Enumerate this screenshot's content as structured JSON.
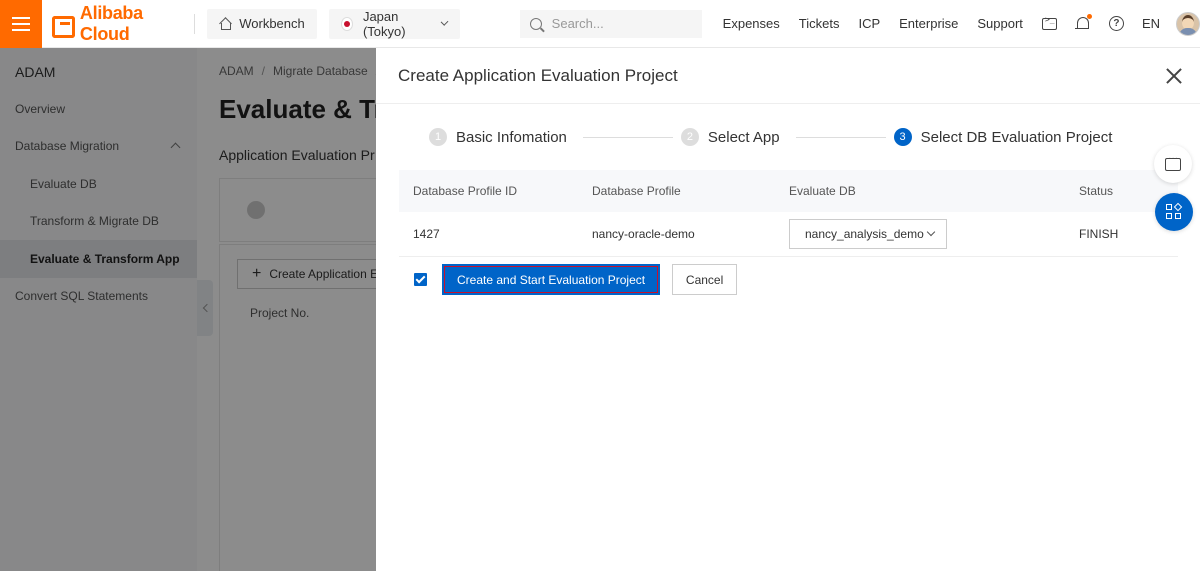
{
  "topbar": {
    "brand": "Alibaba Cloud",
    "workbench": "Workbench",
    "region": "Japan (Tokyo)",
    "search_placeholder": "Search...",
    "links": [
      "Expenses",
      "Tickets",
      "ICP",
      "Enterprise",
      "Support"
    ],
    "language": "EN"
  },
  "sidebar": {
    "title": "ADAM",
    "items": [
      {
        "label": "Overview"
      },
      {
        "label": "Database Migration"
      },
      {
        "label": "Evaluate DB"
      },
      {
        "label": "Transform & Migrate DB"
      },
      {
        "label": "Evaluate & Transform App"
      },
      {
        "label": "Convert SQL Statements"
      }
    ]
  },
  "main": {
    "breadcrumb": [
      "ADAM",
      "Migrate Database",
      "/"
    ],
    "title": "Evaluate & Tr",
    "subtitle": "Application Evaluation Pr",
    "create_button": "Create Application Ev",
    "project_column": "Project No."
  },
  "drawer": {
    "title": "Create Application Evaluation Project",
    "steps": [
      {
        "num": "1",
        "label": "Basic Infomation"
      },
      {
        "num": "2",
        "label": "Select App"
      },
      {
        "num": "3",
        "label": "Select DB Evaluation Project"
      }
    ],
    "table": {
      "headers": [
        "Database Profile ID",
        "Database Profile",
        "Evaluate DB",
        "Status"
      ],
      "row": {
        "id": "1427",
        "profile": "nancy-oracle-demo",
        "evaluate_db": "nancy_analysis_demo",
        "status": "FINISH"
      }
    },
    "primary_button": "Create and Start Evaluation Project",
    "cancel_button": "Cancel"
  },
  "colors": {
    "brand": "#ff6a00",
    "primary": "#0064c8",
    "highlight": "#c8102e"
  }
}
